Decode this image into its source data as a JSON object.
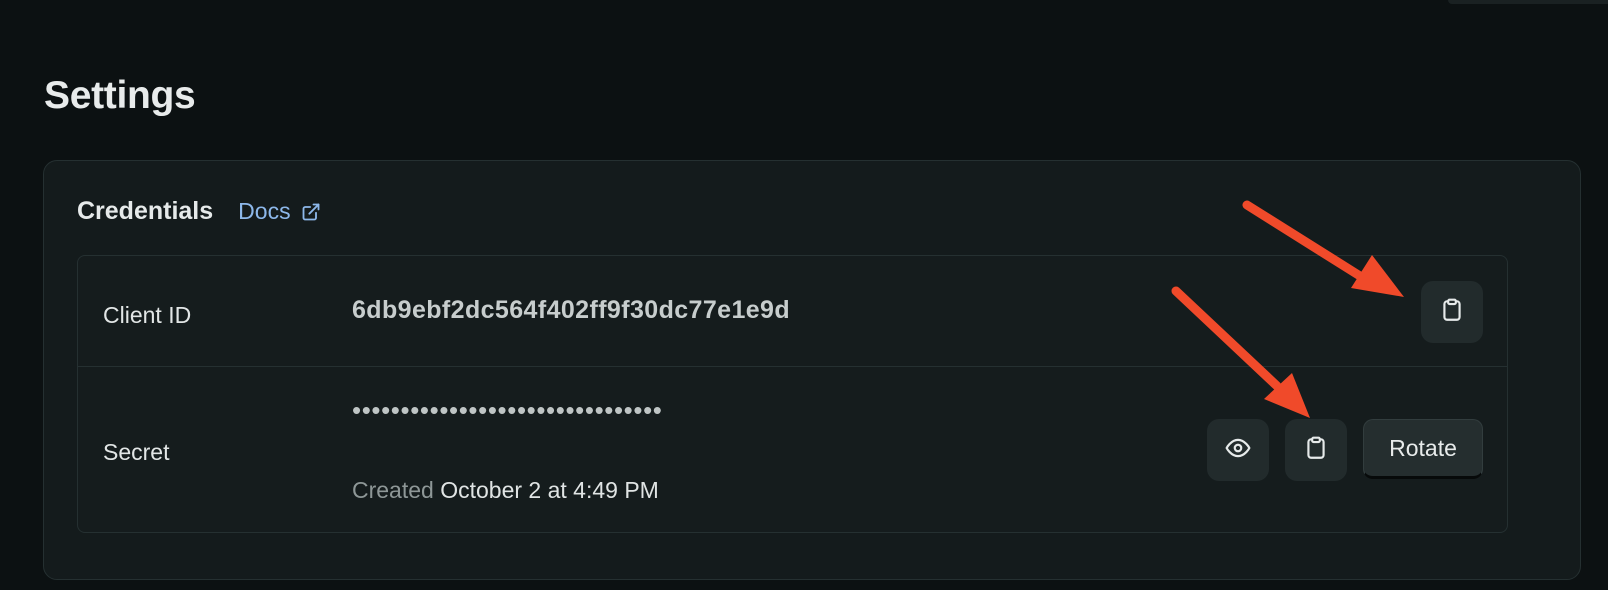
{
  "page": {
    "title": "Settings"
  },
  "credentials": {
    "title": "Credentials",
    "docs_label": "Docs",
    "client_id": {
      "label": "Client ID",
      "value": "6db9ebf2dc564f402ff9f30dc77e1e9d",
      "copy_icon": "clipboard-icon"
    },
    "secret": {
      "label": "Secret",
      "masked_value": "••••••••••••••••••••••••••••••••",
      "created_label": "Created",
      "created_date": "October 2 at 4:49 PM",
      "view_icon": "eye-icon",
      "copy_icon": "clipboard-icon",
      "rotate_label": "Rotate"
    }
  },
  "colors": {
    "background": "#0c1112",
    "panel": "#141b1c",
    "link": "#8db8ea",
    "annotation_arrow": "#f04a2a"
  }
}
